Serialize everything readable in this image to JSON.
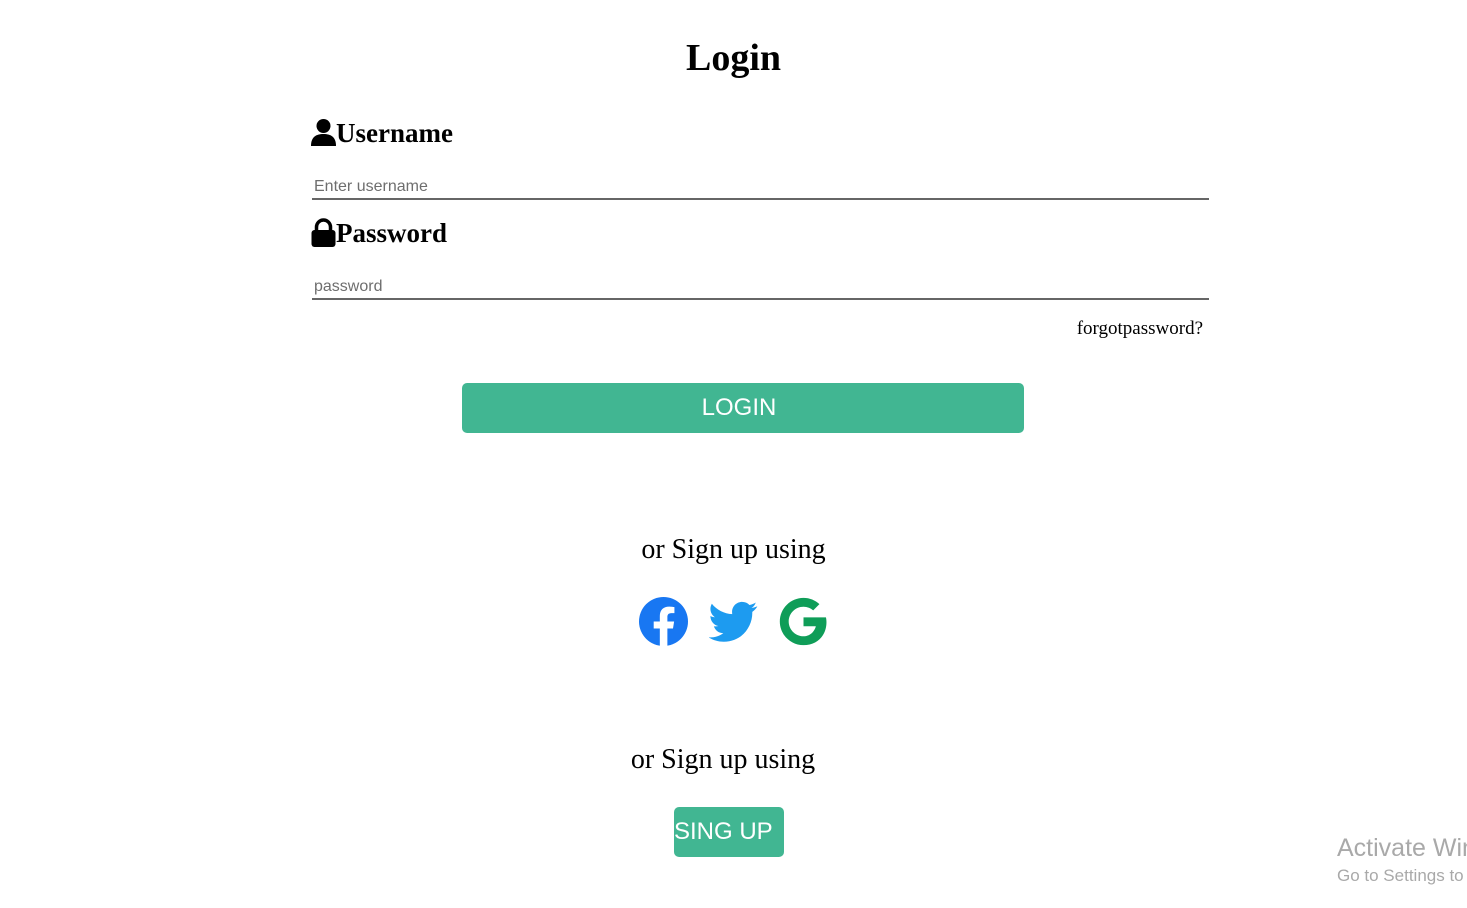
{
  "page": {
    "title": "Login"
  },
  "form": {
    "username": {
      "label": "Username",
      "placeholder": "Enter username",
      "value": "",
      "icon": "user-icon"
    },
    "password": {
      "label": "Password",
      "placeholder": "password",
      "value": "",
      "icon": "lock-icon"
    },
    "forgot_label": "forgotpassword?",
    "login_label": "LOGIN"
  },
  "social": {
    "heading": "or Sign up using",
    "items": [
      {
        "name": "facebook-icon",
        "color": "#1877f2"
      },
      {
        "name": "twitter-icon",
        "color": "#1d9bf0"
      },
      {
        "name": "google-icon",
        "color": "#0f9d58"
      }
    ]
  },
  "signup": {
    "heading": "or Sign up using",
    "button_label": "SING UP"
  },
  "colors": {
    "accent": "#41b692",
    "text": "#000000",
    "watermark": "#a9a9a9"
  },
  "watermark": {
    "title": "Activate Windows",
    "subtitle": "Go to Settings to activate Windows."
  }
}
